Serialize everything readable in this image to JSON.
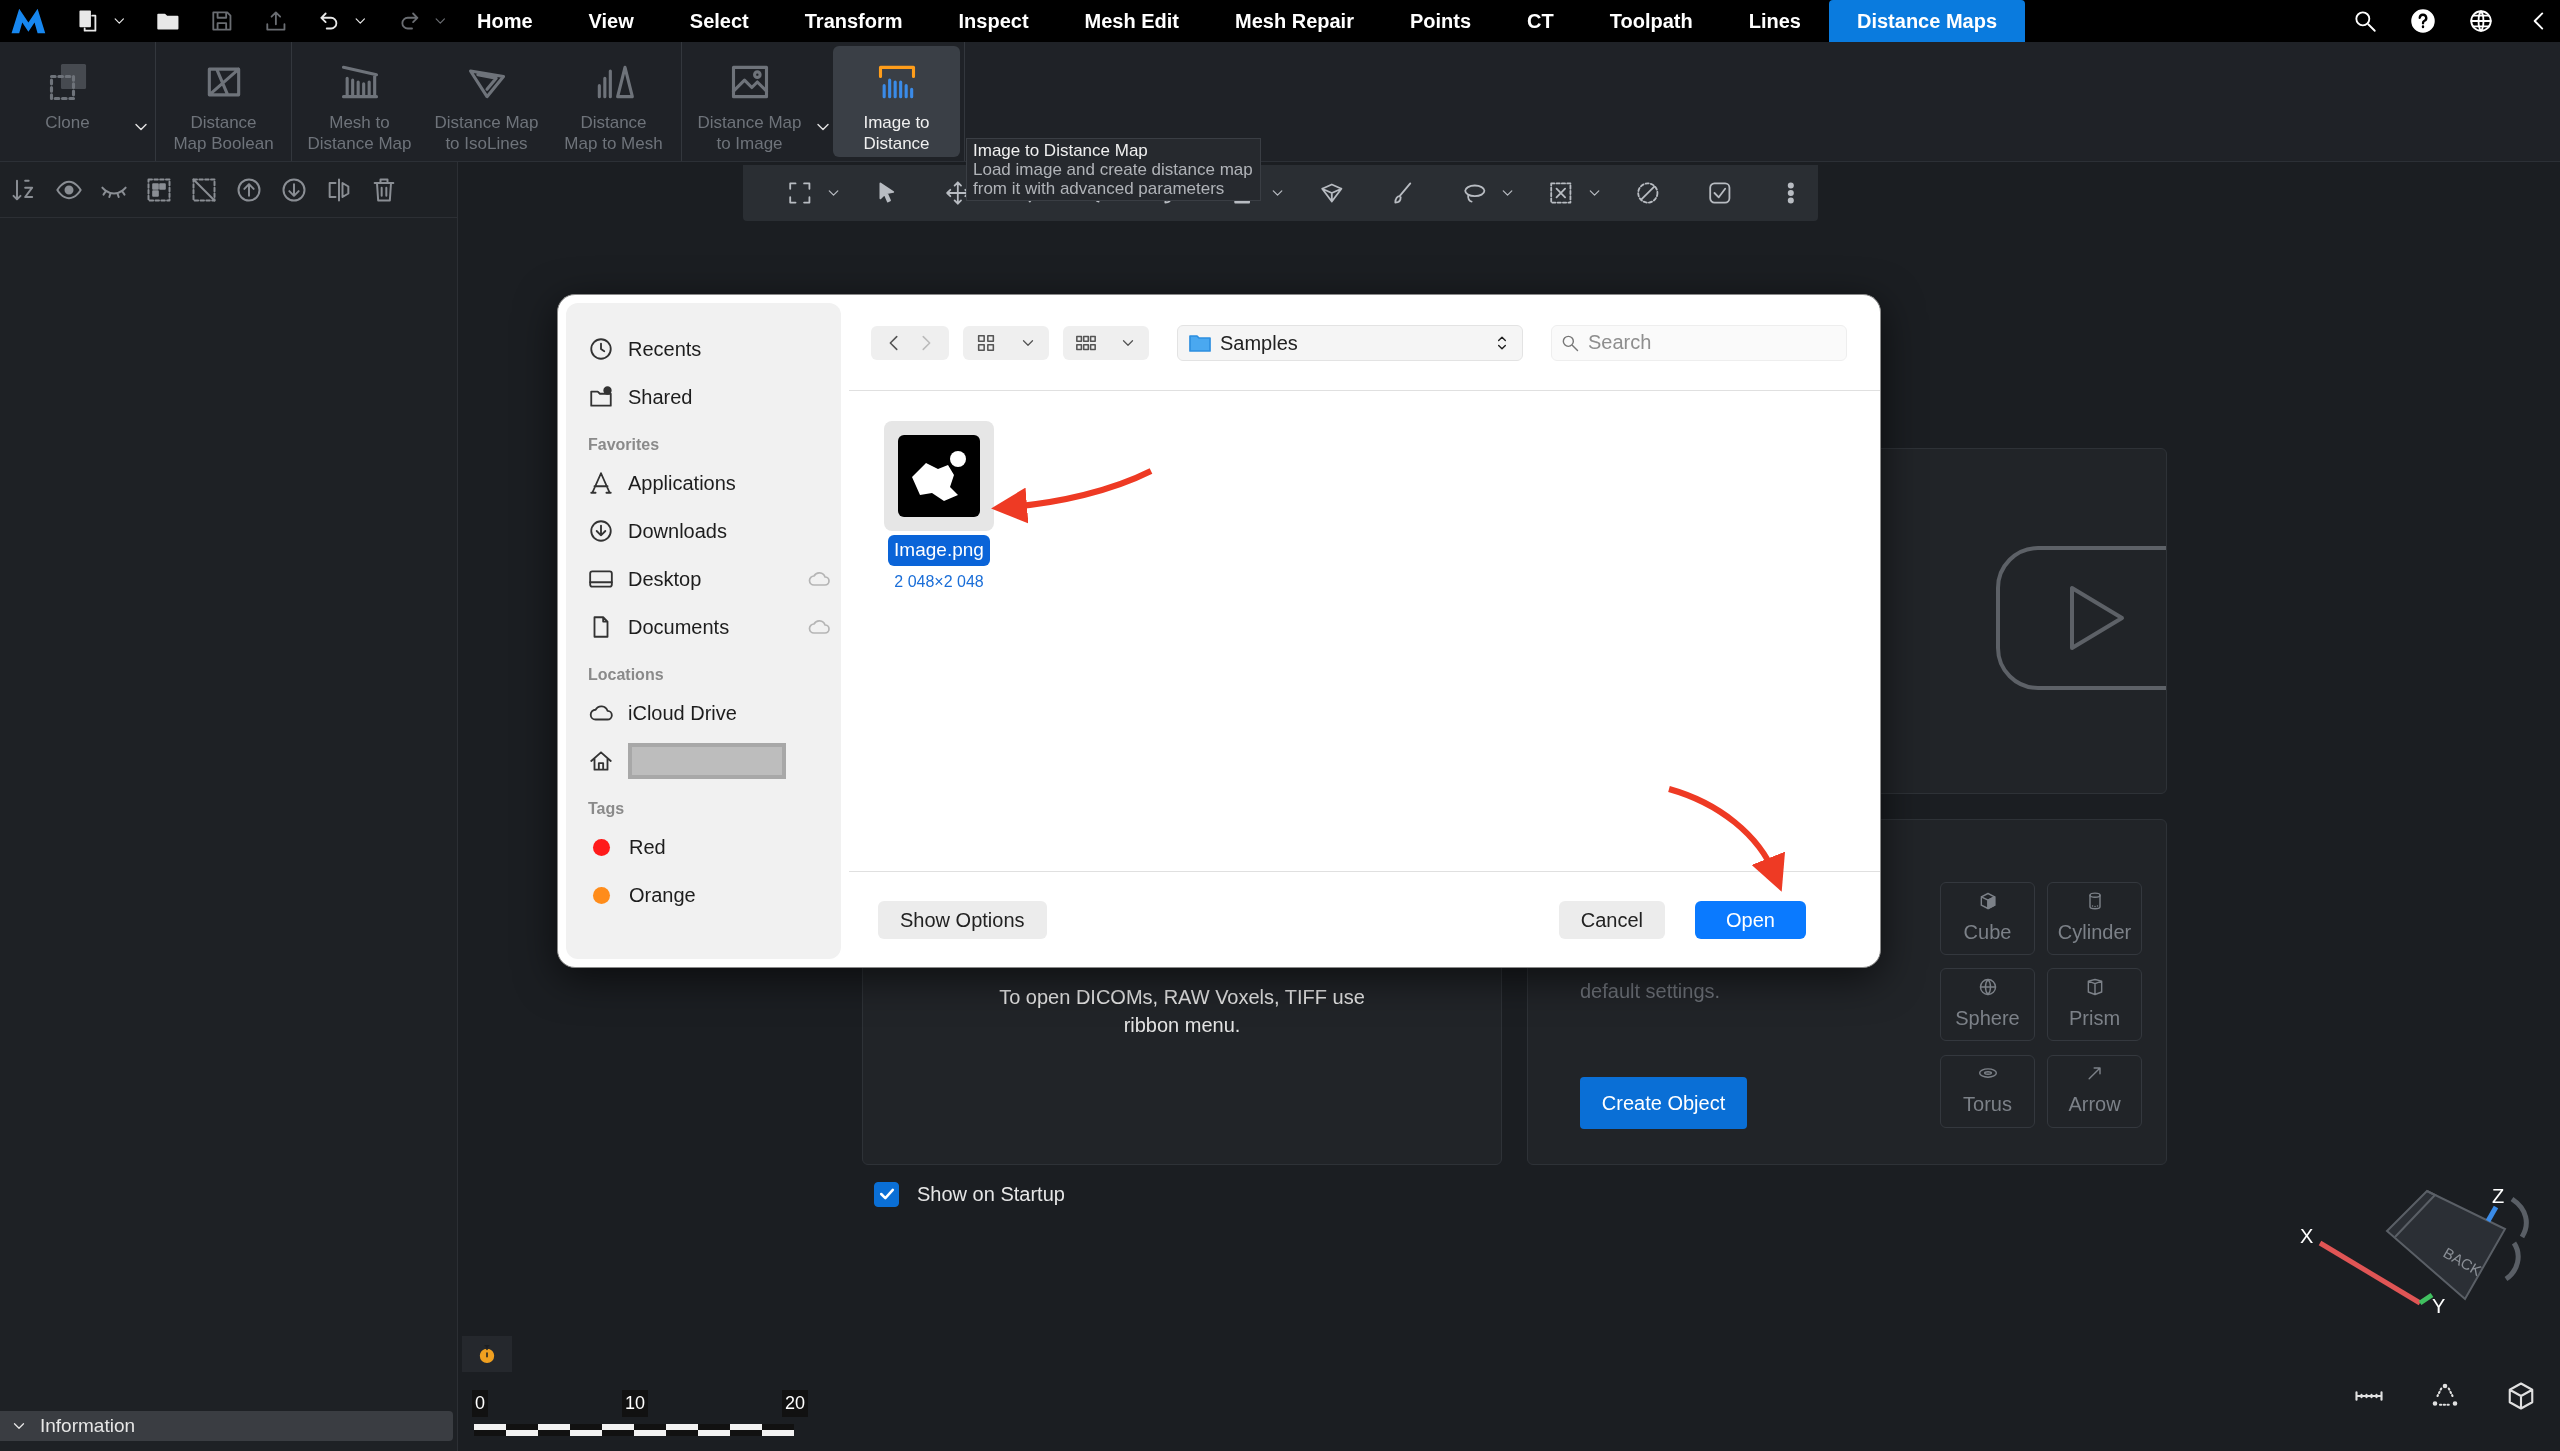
{
  "menu_bar": {
    "quick_actions": [
      {
        "kind": "file",
        "dropdown": true,
        "disabled": false
      },
      {
        "kind": "folder",
        "dropdown": false,
        "disabled": false
      },
      {
        "kind": "save",
        "dropdown": false,
        "disabled": true
      },
      {
        "kind": "export",
        "dropdown": false,
        "disabled": true
      },
      {
        "kind": "undo",
        "dropdown": true,
        "disabled": false
      },
      {
        "kind": "redo",
        "dropdown": true,
        "disabled": true
      }
    ],
    "tabs": [
      {
        "label": "Home",
        "selected": false
      },
      {
        "label": "View",
        "selected": false
      },
      {
        "label": "Select",
        "selected": false
      },
      {
        "label": "Transform",
        "selected": false
      },
      {
        "label": "Inspect",
        "selected": false
      },
      {
        "label": "Mesh Edit",
        "selected": false
      },
      {
        "label": "Mesh Repair",
        "selected": false
      },
      {
        "label": "Points",
        "selected": false
      },
      {
        "label": "CT",
        "selected": false
      },
      {
        "label": "Toolpath",
        "selected": false
      },
      {
        "label": "Lines",
        "selected": false
      },
      {
        "label": "Distance Maps",
        "selected": true
      }
    ]
  },
  "ribbon": [
    {
      "items": [
        {
          "kind": "clone",
          "label": "Clone",
          "disabled": true,
          "selected": false,
          "dropdown": true
        }
      ]
    },
    {
      "items": [
        {
          "kind": "boolean",
          "label": "Distance\nMap Boolean",
          "disabled": true,
          "selected": false,
          "dropdown": false
        }
      ]
    },
    {
      "items": [
        {
          "kind": "mesh-to-map",
          "label": "Mesh to\nDistance Map",
          "disabled": true,
          "selected": false,
          "dropdown": false
        },
        {
          "kind": "isolines",
          "label": "Distance Map\nto IsoLines",
          "disabled": true,
          "selected": false,
          "dropdown": false
        },
        {
          "kind": "map-to-mesh",
          "label": "Distance\nMap to Mesh",
          "disabled": true,
          "selected": false,
          "dropdown": false
        }
      ]
    },
    {
      "items": [
        {
          "kind": "map-to-image",
          "label": "Distance Map\nto Image",
          "disabled": true,
          "selected": false,
          "dropdown": true
        },
        {
          "kind": "image-to-map",
          "label": "Image to\nDistance",
          "disabled": false,
          "selected": true,
          "dropdown": false
        }
      ]
    }
  ],
  "tooltip": {
    "title": "Image to Distance Map",
    "text": "Load image and create distance map\nfrom it with advanced parameters"
  },
  "left_panel": {
    "footer": "Information"
  },
  "welcome": {
    "import_hint": "To open DICOMs, RAW Voxels, TIFF use\nribbon menu.",
    "create_hint": "default settings.",
    "create_button": "Create Object",
    "shapes": [
      {
        "kind": "cube",
        "label": "Cube"
      },
      {
        "kind": "cylinder",
        "label": "Cylinder"
      },
      {
        "kind": "sphere",
        "label": "Sphere"
      },
      {
        "kind": "prism",
        "label": "Prism"
      },
      {
        "kind": "torus",
        "label": "Torus"
      },
      {
        "kind": "arrow",
        "label": "Arrow"
      }
    ],
    "show_on_startup": {
      "label": "Show on Startup",
      "checked": true
    }
  },
  "dialog": {
    "sidebar": [
      {
        "items": [
          {
            "kind": "clock",
            "label": "Recents",
            "cloud": false
          },
          {
            "kind": "shared",
            "label": "Shared",
            "cloud": false
          }
        ]
      },
      {
        "heading": "Favorites",
        "items": [
          {
            "kind": "apps",
            "label": "Applications",
            "cloud": false
          },
          {
            "kind": "download",
            "label": "Downloads",
            "cloud": false
          },
          {
            "kind": "desktop",
            "label": "Desktop",
            "cloud": true
          },
          {
            "kind": "document",
            "label": "Documents",
            "cloud": true
          }
        ]
      },
      {
        "heading": "Locations",
        "items": [
          {
            "kind": "cloud",
            "label": "iCloud Drive",
            "cloud": false
          },
          {
            "kind": "home",
            "redacted": true,
            "cloud": false
          }
        ]
      },
      {
        "heading": "Tags",
        "items": [
          {
            "kind": "tag",
            "label": "Red",
            "color": "#ff1a1a",
            "cloud": false
          },
          {
            "kind": "tag",
            "label": "Orange",
            "color": "#ff8c1a",
            "cloud": false
          }
        ]
      }
    ],
    "location": "Samples",
    "search_placeholder": "Search",
    "files": [
      {
        "name": "Image.png",
        "size": "2 048×2 048",
        "selected": true
      }
    ],
    "buttons": [
      {
        "label": "Show Options",
        "kind": "secondary"
      },
      {
        "label": "Cancel",
        "kind": "secondary"
      },
      {
        "label": "Open",
        "kind": "primary"
      }
    ]
  },
  "scale_bar": {
    "ticks": [
      "0",
      "10",
      "20"
    ]
  },
  "gizmo": {
    "face": "BACK",
    "axes": [
      "X",
      "Y",
      "Z"
    ]
  }
}
